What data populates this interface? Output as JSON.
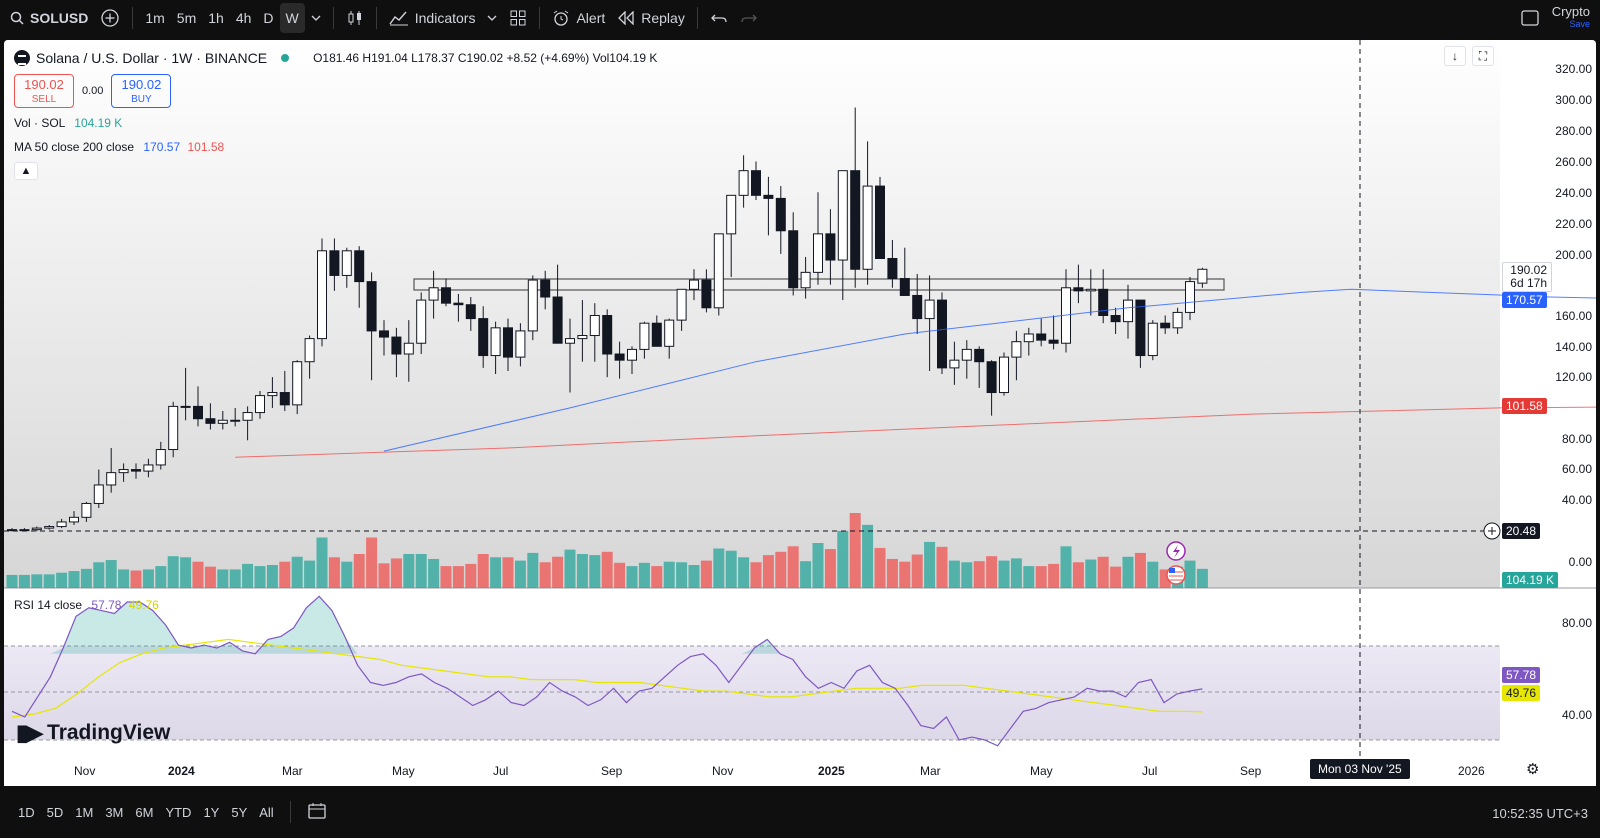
{
  "toolbar": {
    "symbol": "SOLUSD",
    "intervals": [
      "1m",
      "5m",
      "1h",
      "4h",
      "D",
      "W"
    ],
    "active_interval": "W",
    "indicators_label": "Indicators",
    "alert_label": "Alert",
    "replay_label": "Replay",
    "crypto_label": "Crypto",
    "save_label": "Save"
  },
  "legend": {
    "title": "Solana / U.S. Dollar · 1W · BINANCE",
    "ohlc": "O181.46  H191.04  L178.37  C190.02  +8.52 (+4.69%)  Vol104.19 K",
    "sell_price": "190.02",
    "sell_label": "SELL",
    "spread": "0.00",
    "buy_price": "190.02",
    "buy_label": "BUY",
    "vol_name": "Vol · SOL",
    "vol_value": "104.19 K",
    "ma_name": "MA 50 close 200 close",
    "ma50_value": "170.57",
    "ma200_value": "101.58",
    "rsi_name": "RSI 14 close",
    "rsi_value": "57.78",
    "rsi_ma_value": "49.76"
  },
  "price_axis": {
    "ticks": [
      "320.00",
      "300.00",
      "280.00",
      "260.00",
      "240.00",
      "220.00",
      "200.00",
      "160.00",
      "140.00",
      "120.00",
      "80.00",
      "60.00",
      "40.00",
      "0.00"
    ],
    "last_price": "190.02",
    "countdown": "6d 17h",
    "ma50_badge": "170.57",
    "ma200_badge": "101.58",
    "crosshair_badge": "20.48",
    "vol_badge": "104.19 K"
  },
  "rsi_axis": {
    "ticks": [
      "80.00",
      "40.00"
    ],
    "rsi_badge": "57.78",
    "rsi_ma_badge": "49.76"
  },
  "time_axis": {
    "labels": [
      "Nov",
      "2024",
      "Mar",
      "May",
      "Jul",
      "Sep",
      "Nov",
      "2025",
      "Mar",
      "May",
      "Jul",
      "Sep",
      "2026"
    ],
    "crosshair_label": "Mon 03 Nov '25"
  },
  "ranges": [
    "1D",
    "5D",
    "1M",
    "3M",
    "6M",
    "YTD",
    "1Y",
    "5Y",
    "All"
  ],
  "clock": "10:52:35 UTC+3",
  "brand": "TradingView",
  "colors": {
    "up": "#26a69a",
    "down": "#ef5350",
    "ma50": "#2962ff",
    "ma200": "#ef5350",
    "rsi": "#7e57c2",
    "rsi_ma": "#e6e600"
  },
  "chart_data": {
    "type": "candlestick",
    "interval": "1W",
    "ylim": [
      0,
      320
    ],
    "resistance_zone": [
      180,
      187
    ],
    "candles_ohlc": [
      [
        21,
        22,
        20,
        21
      ],
      [
        21,
        22,
        20,
        21
      ],
      [
        21,
        23,
        20,
        22
      ],
      [
        22,
        24,
        21,
        23
      ],
      [
        23,
        28,
        22,
        26
      ],
      [
        26,
        33,
        24,
        29
      ],
      [
        29,
        39,
        26,
        38
      ],
      [
        38,
        60,
        35,
        50
      ],
      [
        50,
        74,
        45,
        58
      ],
      [
        58,
        64,
        52,
        60
      ],
      [
        60,
        64,
        54,
        59
      ],
      [
        59,
        67,
        55,
        63
      ],
      [
        63,
        78,
        60,
        73
      ],
      [
        73,
        104,
        68,
        101
      ],
      [
        101,
        126,
        92,
        101
      ],
      [
        101,
        114,
        88,
        93
      ],
      [
        93,
        103,
        86,
        90
      ],
      [
        90,
        98,
        86,
        92
      ],
      [
        92,
        100,
        88,
        92
      ],
      [
        92,
        101,
        79,
        97
      ],
      [
        97,
        111,
        93,
        108
      ],
      [
        108,
        120,
        100,
        110
      ],
      [
        110,
        124,
        98,
        102
      ],
      [
        102,
        131,
        96,
        130
      ],
      [
        130,
        147,
        119,
        145
      ],
      [
        145,
        210,
        140,
        202
      ],
      [
        202,
        210,
        176,
        186
      ],
      [
        186,
        204,
        178,
        202
      ],
      [
        202,
        205,
        165,
        182
      ],
      [
        182,
        188,
        118,
        150
      ],
      [
        150,
        157,
        134,
        146
      ],
      [
        146,
        152,
        120,
        135
      ],
      [
        135,
        157,
        117,
        142
      ],
      [
        142,
        175,
        135,
        170
      ],
      [
        170,
        189,
        158,
        178
      ],
      [
        178,
        184,
        166,
        168
      ],
      [
        168,
        174,
        156,
        167
      ],
      [
        167,
        172,
        150,
        158
      ],
      [
        158,
        166,
        126,
        134
      ],
      [
        134,
        156,
        122,
        152
      ],
      [
        152,
        158,
        124,
        133
      ],
      [
        133,
        155,
        127,
        150
      ],
      [
        150,
        186,
        144,
        183
      ],
      [
        183,
        189,
        164,
        172
      ],
      [
        172,
        193,
        158,
        142
      ],
      [
        142,
        158,
        110,
        145
      ],
      [
        145,
        170,
        130,
        147
      ],
      [
        147,
        168,
        130,
        160
      ],
      [
        160,
        164,
        120,
        135
      ],
      [
        135,
        143,
        119,
        131
      ],
      [
        131,
        140,
        122,
        138
      ],
      [
        138,
        156,
        132,
        155
      ],
      [
        155,
        160,
        142,
        140
      ],
      [
        140,
        158,
        132,
        157
      ],
      [
        157,
        175,
        150,
        177
      ],
      [
        177,
        190,
        170,
        183
      ],
      [
        183,
        190,
        162,
        165
      ],
      [
        165,
        210,
        160,
        213
      ],
      [
        213,
        231,
        185,
        238
      ],
      [
        238,
        264,
        230,
        254
      ],
      [
        254,
        260,
        235,
        238
      ],
      [
        238,
        250,
        212,
        236
      ],
      [
        236,
        244,
        200,
        215
      ],
      [
        215,
        227,
        173,
        178
      ],
      [
        178,
        198,
        171,
        188
      ],
      [
        188,
        240,
        180,
        213
      ],
      [
        213,
        229,
        180,
        196
      ],
      [
        196,
        252,
        170,
        254
      ],
      [
        254,
        295,
        178,
        190
      ],
      [
        190,
        273,
        180,
        244
      ],
      [
        244,
        250,
        199,
        197
      ],
      [
        197,
        209,
        178,
        184
      ],
      [
        184,
        204,
        178,
        173
      ],
      [
        173,
        187,
        148,
        158
      ],
      [
        158,
        186,
        124,
        170
      ],
      [
        170,
        175,
        122,
        126
      ],
      [
        126,
        143,
        115,
        131
      ],
      [
        131,
        144,
        119,
        138
      ],
      [
        138,
        140,
        113,
        130
      ],
      [
        130,
        131,
        95,
        110
      ],
      [
        110,
        136,
        108,
        133
      ],
      [
        133,
        150,
        118,
        143
      ],
      [
        143,
        152,
        134,
        148
      ],
      [
        148,
        158,
        140,
        144
      ],
      [
        144,
        160,
        138,
        142
      ],
      [
        142,
        190,
        136,
        178
      ],
      [
        178,
        193,
        168,
        176
      ],
      [
        176,
        190,
        160,
        177
      ],
      [
        177,
        190,
        155,
        160
      ],
      [
        160,
        165,
        148,
        156
      ],
      [
        156,
        180,
        145,
        170
      ],
      [
        170,
        168,
        126,
        134
      ],
      [
        134,
        157,
        131,
        155
      ],
      [
        155,
        160,
        148,
        152
      ],
      [
        152,
        165,
        148,
        162
      ],
      [
        162,
        185,
        157,
        182
      ],
      [
        181,
        191,
        178,
        190
      ]
    ],
    "volume_down_weeks": "red bars = down candle weeks",
    "ma50": [
      [
        30,
        72
      ],
      [
        45,
        100
      ],
      [
        60,
        130
      ],
      [
        72,
        148
      ],
      [
        90,
        165
      ],
      [
        104,
        175
      ],
      [
        108,
        177
      ],
      [
        124,
        172
      ],
      [
        130,
        171
      ],
      [
        135,
        170
      ],
      [
        143,
        170.57
      ]
    ],
    "ma200": [
      [
        18,
        68
      ],
      [
        40,
        74
      ],
      [
        60,
        82
      ],
      [
        80,
        89
      ],
      [
        100,
        96
      ],
      [
        120,
        100
      ],
      [
        135,
        101
      ],
      [
        143,
        101.58
      ]
    ],
    "rsi": [
      50,
      48,
      55,
      62,
      72,
      83,
      86,
      85,
      84,
      88,
      88,
      85,
      80,
      73,
      72,
      73,
      72,
      74,
      71,
      70,
      75,
      76,
      79,
      86,
      90,
      85,
      76,
      66,
      60,
      59,
      60,
      62,
      63,
      60,
      58,
      55,
      52,
      54,
      57,
      53,
      52,
      55,
      60,
      57,
      55,
      52,
      54,
      58,
      53,
      57,
      58,
      62,
      66,
      69,
      70,
      66,
      60,
      66,
      72,
      75,
      70,
      68,
      62,
      58,
      60,
      58,
      64,
      66,
      60,
      58,
      52,
      45,
      44,
      48,
      40,
      41,
      40,
      38,
      44,
      50,
      51,
      53,
      54,
      55,
      58,
      57,
      57,
      55,
      60,
      61,
      53,
      56,
      57,
      57.78
    ],
    "rsi_ma": [
      48,
      49,
      51,
      56,
      62,
      67,
      70,
      72,
      73,
      74,
      75,
      74,
      73,
      72,
      71,
      70,
      69,
      68,
      66,
      65,
      64,
      63,
      62,
      62,
      61,
      61,
      61,
      60,
      60,
      60,
      59,
      58,
      57,
      57,
      56,
      55,
      55,
      56,
      57,
      58,
      58,
      58,
      59,
      59,
      59,
      58,
      57,
      56,
      55,
      54,
      53,
      52,
      51,
      50,
      50,
      49.76
    ]
  }
}
